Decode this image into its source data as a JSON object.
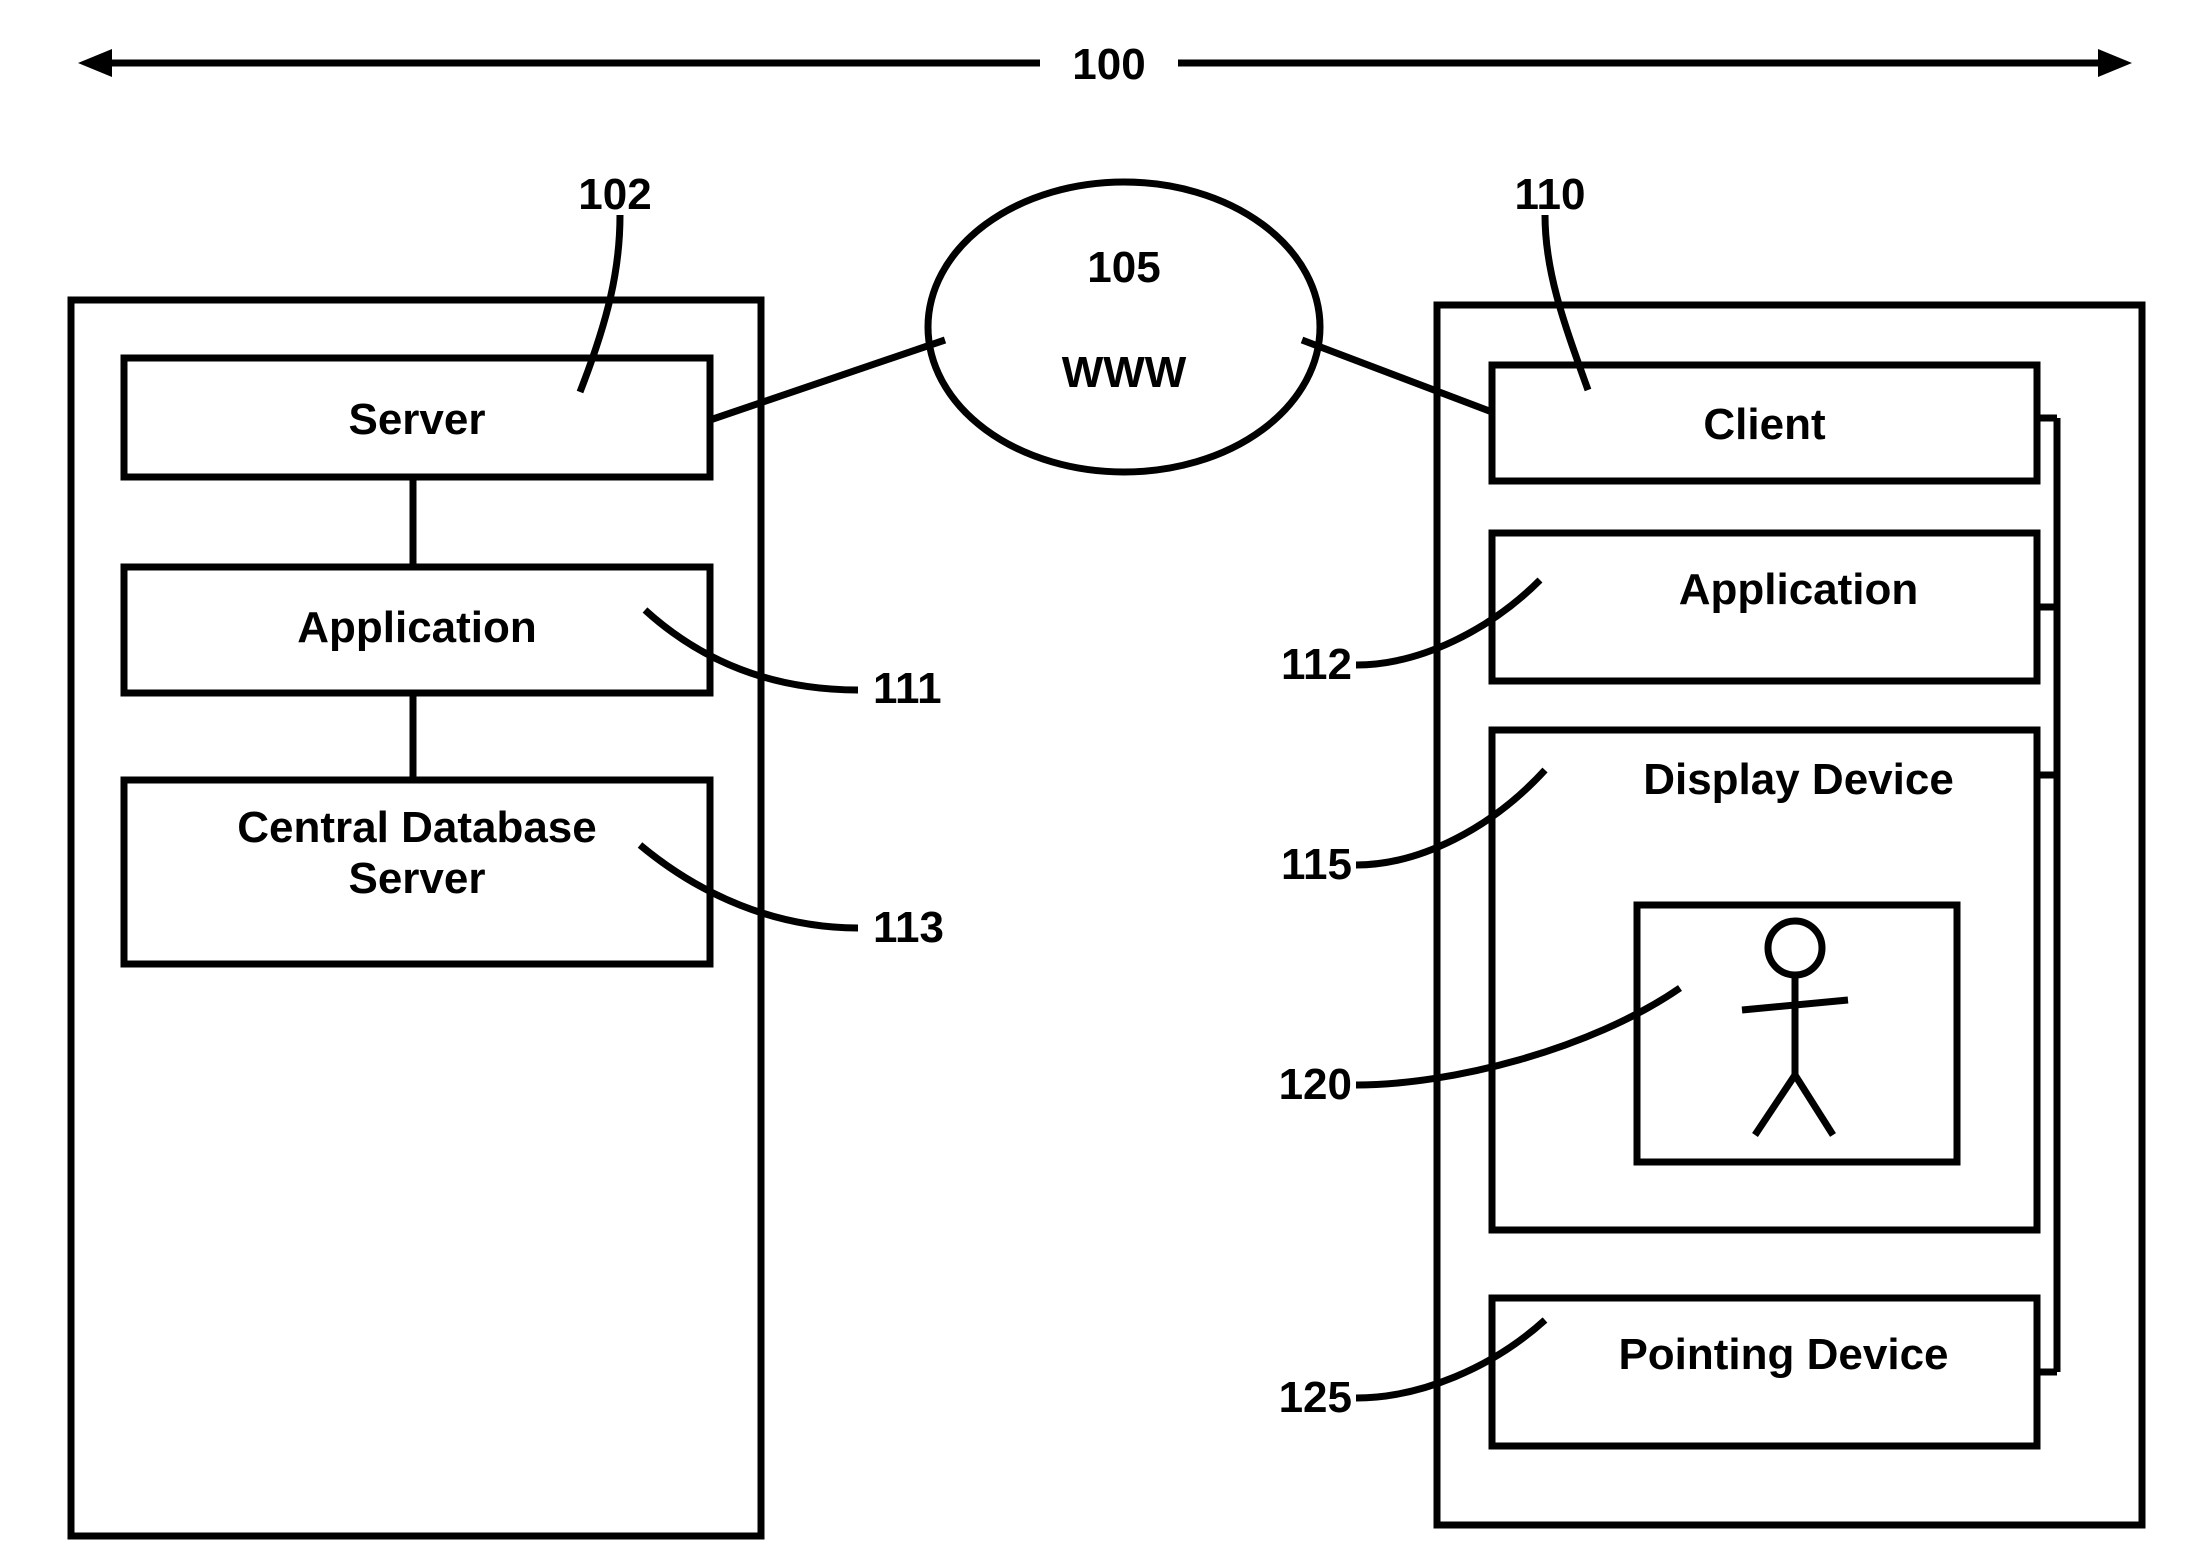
{
  "figure": {
    "overall_label": "100",
    "server_side": {
      "group_label": "102",
      "boxes": [
        {
          "id": "server",
          "label": "Server",
          "ref": ""
        },
        {
          "id": "application",
          "label": "Application",
          "ref": "111"
        },
        {
          "id": "central-database-server",
          "label": "Central Database\nServer",
          "ref": "113"
        }
      ]
    },
    "network": {
      "ref": "105",
      "label": "WWW"
    },
    "client_side": {
      "group_label": "110",
      "boxes": [
        {
          "id": "client",
          "label": "Client",
          "ref": ""
        },
        {
          "id": "application",
          "label": "Application",
          "ref": "112"
        },
        {
          "id": "display-device",
          "label": "Display Device",
          "ref": "115"
        },
        {
          "id": "stick-figure",
          "label": "",
          "ref": "120"
        },
        {
          "id": "pointing-device",
          "label": "Pointing Device",
          "ref": "125"
        }
      ]
    },
    "refs": {
      "r100": "100",
      "r102": "102",
      "r105": "105",
      "r110": "110",
      "r111": "111",
      "r112": "112",
      "r113": "113",
      "r115": "115",
      "r120": "120",
      "r125": "125"
    },
    "colors": {
      "stroke": "#000000",
      "background": "#ffffff"
    }
  }
}
